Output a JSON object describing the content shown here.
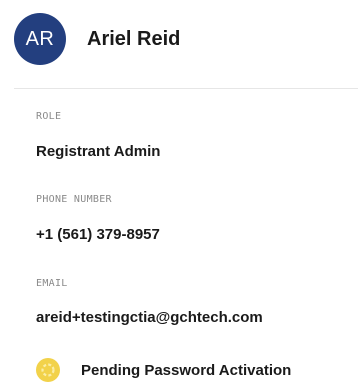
{
  "user": {
    "initials": "AR",
    "name": "Ariel Reid",
    "avatar_color": "#233f7f"
  },
  "fields": {
    "role": {
      "label": "ROLE",
      "value": "Registrant Admin"
    },
    "phone": {
      "label": "PHONE NUMBER",
      "value": "+1 (561) 379-8957"
    },
    "email": {
      "label": "EMAIL",
      "value": "areid+testingctia@gchtech.com"
    }
  },
  "status": {
    "text": "Pending Password Activation",
    "icon": "pending-icon",
    "color": "#f2d24a"
  }
}
